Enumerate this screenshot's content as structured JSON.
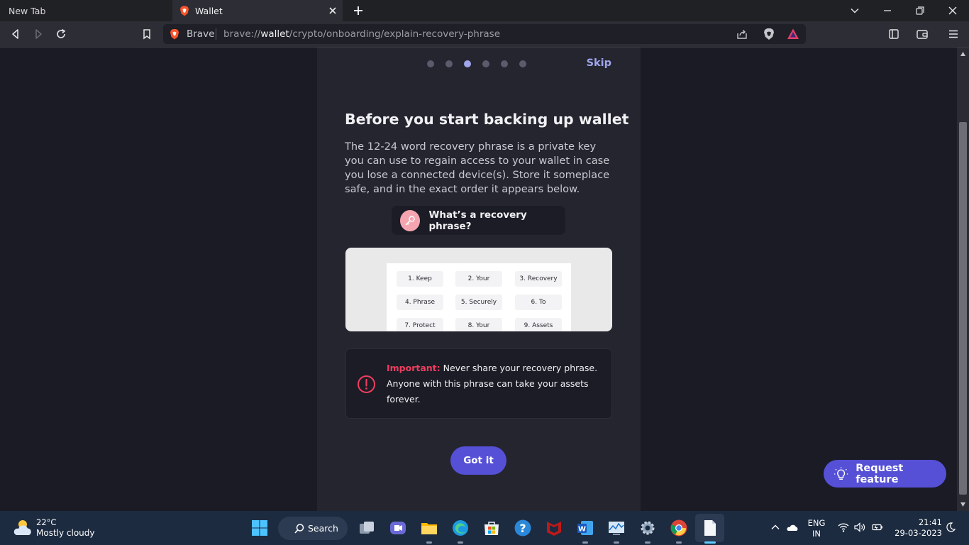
{
  "tabs": [
    {
      "label": "New Tab"
    },
    {
      "label": "Wallet"
    }
  ],
  "omnibox": {
    "brand": "Brave",
    "url_scheme": "brave://",
    "url_host": "wallet",
    "url_path": "/crypto/onboarding/explain-recovery-phrase"
  },
  "onboarding": {
    "steps_total": 6,
    "current_step": 3,
    "skip_label": "Skip",
    "title": "Before you start backing up wallet",
    "description": "The 12-24 word recovery phrase is a private key you can use to regain access to your wallet in case you lose a connected device(s). Store it someplace safe, and in the exact order it appears below.",
    "recovery_link": "What’s a recovery phrase?",
    "preview_words": [
      "1. Keep",
      "2. Your",
      "3. Recovery",
      "4. Phrase",
      "5. Securely",
      "6. To",
      "7. Protect",
      "8. Your",
      "9. Assets"
    ],
    "warning_label": "Important:",
    "warning_text": " Never share your recovery phrase. Anyone with this phrase can take your assets forever.",
    "cta_label": "Got it"
  },
  "request_feature": {
    "label": "Request feature"
  },
  "taskbar": {
    "weather_temp": "22°C",
    "weather_cond": "Mostly cloudy",
    "search_label": "Search",
    "lang_top": "ENG",
    "lang_bottom": "IN",
    "time": "21:41",
    "date": "29-03-2023"
  },
  "colors": {
    "accent": "#5550d6",
    "dot_active": "#a0a5eb",
    "warning": "#ef3d5f"
  }
}
